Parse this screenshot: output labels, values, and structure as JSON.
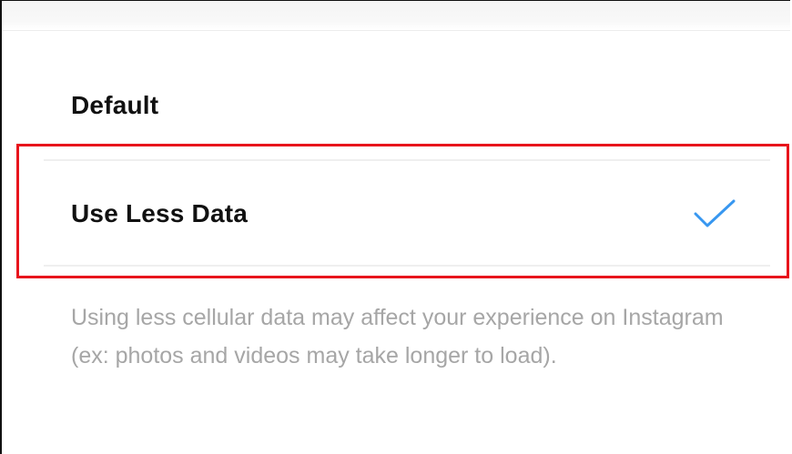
{
  "options": [
    {
      "label": "Default",
      "selected": false
    },
    {
      "label": "Use Less Data",
      "selected": true
    }
  ],
  "description": "Using less cellular data may affect your experience on Instagram (ex: photos and videos may take longer to load).",
  "icons": {
    "selected_mark": "checkmark-icon"
  },
  "colors": {
    "checkmark": "#3897f0",
    "highlight_border": "#e8141c",
    "option_text": "#111111",
    "description_text": "#a6a6a6",
    "divider": "#efefef"
  }
}
